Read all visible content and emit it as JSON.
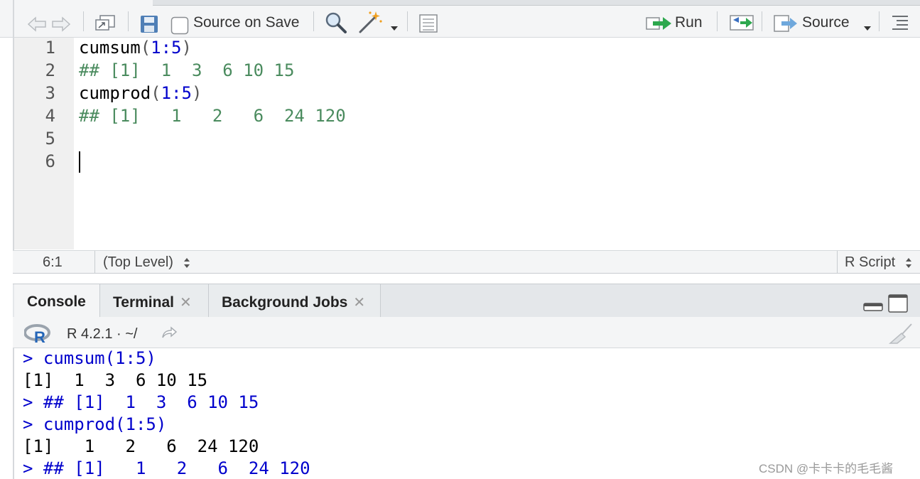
{
  "toolbar": {
    "source_on_save_label": "Source on Save",
    "source_on_save_checked": false,
    "run_label": "Run",
    "source_label": "Source",
    "icons": [
      "back-arrow-icon",
      "forward-arrow-icon",
      "show-in-window-icon",
      "save-icon",
      "search-icon",
      "magic-wand-icon",
      "compile-report-icon",
      "run-icon",
      "rerun-icon",
      "source-icon",
      "outline-icon"
    ]
  },
  "editor": {
    "line_numbers": [
      "1",
      "2",
      "3",
      "4",
      "5",
      "6"
    ],
    "lines": [
      {
        "fn": "cumsum",
        "open": "(",
        "arg": "1:5",
        "close": ")"
      },
      {
        "comment": "## [1]  1  3  6 10 15"
      },
      {
        "fn": "cumprod",
        "open": "(",
        "arg": "1:5",
        "close": ")"
      },
      {
        "comment": "## [1]   1   2   6  24 120"
      },
      {
        "comment": ""
      },
      {
        "comment": ""
      }
    ]
  },
  "status": {
    "position": "6:1",
    "scope": "(Top Level)",
    "file_type": "R Script"
  },
  "console_tabs": [
    {
      "label": "Console",
      "closable": false,
      "active": true
    },
    {
      "label": "Terminal",
      "closable": true,
      "active": false
    },
    {
      "label": "Background Jobs",
      "closable": true,
      "active": false
    }
  ],
  "console_header": {
    "version_text": "R 4.2.1 · ~/"
  },
  "console_lines": [
    {
      "kind": "in",
      "text": "> cumsum(1:5)"
    },
    {
      "kind": "out",
      "text": "[1]  1  3  6 10 15"
    },
    {
      "kind": "in",
      "text": "> ## [1]  1  3  6 10 15"
    },
    {
      "kind": "in",
      "text": "> cumprod(1:5)"
    },
    {
      "kind": "out",
      "text": "[1]   1   2   6  24 120"
    },
    {
      "kind": "in",
      "text": "> ## [1]   1   2   6  24 120"
    }
  ],
  "watermark": "CSDN @卡卡卡的毛毛酱",
  "colors": {
    "toolbar_bg": "#f4f5f6",
    "comment_green": "#4a8b5e",
    "number_blue": "#0000cc",
    "console_input_blue": "#0000cc",
    "run_arrow_green": "#2ea84e"
  }
}
